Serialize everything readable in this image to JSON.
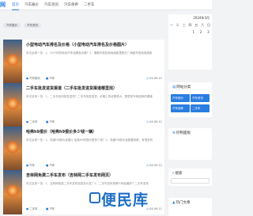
{
  "site": {
    "logo": "网"
  },
  "nav": {
    "items": [
      "首页",
      "汽车报价",
      "汽车资讯",
      "汽车保养",
      "二手车"
    ]
  },
  "breadcrumb": [
    "汽车报价",
    "汽车资讯"
  ],
  "articles": [
    {
      "title": "小型电动汽车排名及价格（小型电动汽车排名及价格图片）",
      "excerpt": "本文目录一览：1、10个好的电动汽车品牌及价格？2、哪款车型的纯电续航里程长？两款车型纯电续航",
      "author": "汽车报价",
      "category": "汽车",
      "date": "04-09-11"
    },
    {
      "title": "二手车批发进货渠道（二手车批发进货渠道哪里找）",
      "excerpt": "本文目录一览：1、二手车如何批发进货？二手车批发进货，价格上的优势很大，是很多车商选择的渠道",
      "author": "二手车",
      "category": "汽车",
      "date": "04-09-11"
    },
    {
      "title": "哈弗h9报价（哈弗h9报价多少钱一辆）",
      "excerpt": "本文目录一览：1、哈弗H9报价及图片 哈弗H9的报价是多少钱？2、哈弗H9报价及配置参数，有很多的",
      "author": "汽车",
      "category": "汽车",
      "date": "04-09-11"
    },
    {
      "title": "吉林网免费二手车发布（吉林网二手车发布网页）",
      "excerpt": "本文目录一览：1、吉林网免费二手车发布信息怎么发？2、二手车发布到哪个网站最好？二手车发布",
      "author": "二手车",
      "category": "汽车",
      "date": "04-09-11"
    }
  ],
  "calendar": {
    "title": "2024年3月",
    "weekdays": [
      "一",
      "二",
      "三",
      "四",
      "五",
      "六",
      "日"
    ],
    "week1": [
      "",
      "",
      "",
      "",
      "1",
      "2",
      "3"
    ]
  },
  "sidebar": {
    "categories_title": "网站分类",
    "categories": [
      "汽车报价",
      "汽车资讯",
      "汽车保养",
      "二手车"
    ],
    "control_title": "控制面板",
    "search_title": "搜索",
    "hot_title": "热门文章"
  },
  "watermark": "便民库",
  "colors": {
    "accent": "#2a7de1"
  }
}
